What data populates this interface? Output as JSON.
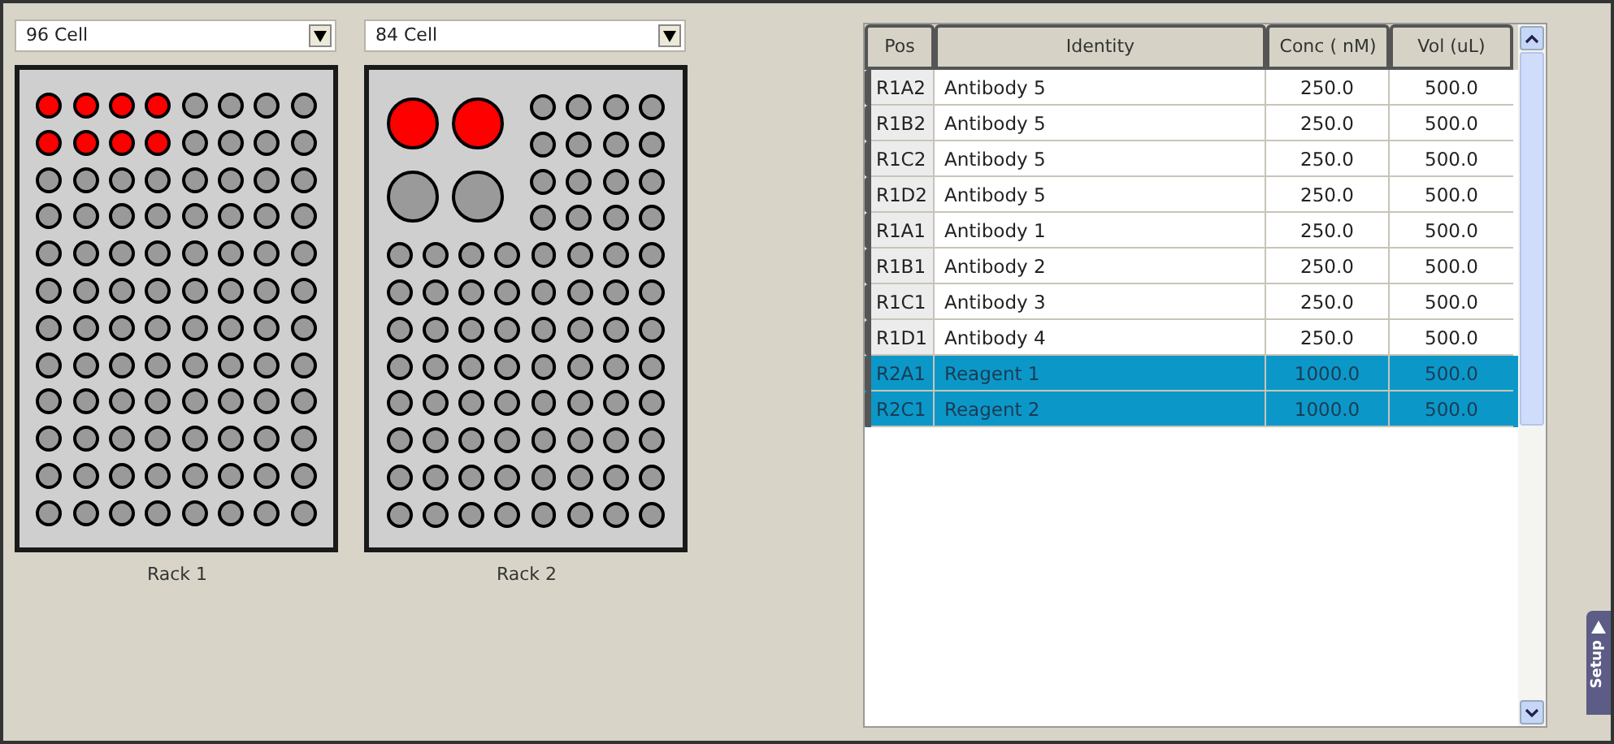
{
  "racks": [
    {
      "kind": "uniform",
      "selector": "96 Cell",
      "label": "Rack 1",
      "rows": [
        [
          true,
          true,
          true,
          true,
          false,
          false,
          false,
          false
        ],
        [
          true,
          true,
          true,
          true,
          false,
          false,
          false,
          false
        ],
        [
          false,
          false,
          false,
          false,
          false,
          false,
          false,
          false
        ],
        [
          false,
          false,
          false,
          false,
          false,
          false,
          false,
          false
        ],
        [
          false,
          false,
          false,
          false,
          false,
          false,
          false,
          false
        ],
        [
          false,
          false,
          false,
          false,
          false,
          false,
          false,
          false
        ],
        [
          false,
          false,
          false,
          false,
          false,
          false,
          false,
          false
        ],
        [
          false,
          false,
          false,
          false,
          false,
          false,
          false,
          false
        ],
        [
          false,
          false,
          false,
          false,
          false,
          false,
          false,
          false
        ],
        [
          false,
          false,
          false,
          false,
          false,
          false,
          false,
          false
        ],
        [
          false,
          false,
          false,
          false,
          false,
          false,
          false,
          false
        ],
        [
          false,
          false,
          false,
          false,
          false,
          false,
          false,
          false
        ]
      ]
    },
    {
      "kind": "mixed",
      "selector": "84 Cell",
      "label": "Rack 2",
      "large_wells": [
        [
          true,
          true
        ],
        [
          false,
          false
        ]
      ],
      "rows": [
        [
          false,
          false,
          false,
          false
        ],
        [
          false,
          false,
          false,
          false
        ],
        [
          false,
          false,
          false,
          false
        ],
        [
          false,
          false,
          false,
          false
        ],
        [
          false,
          false,
          false,
          false,
          false,
          false,
          false,
          false
        ],
        [
          false,
          false,
          false,
          false,
          false,
          false,
          false,
          false
        ],
        [
          false,
          false,
          false,
          false,
          false,
          false,
          false,
          false
        ],
        [
          false,
          false,
          false,
          false,
          false,
          false,
          false,
          false
        ],
        [
          false,
          false,
          false,
          false,
          false,
          false,
          false,
          false
        ],
        [
          false,
          false,
          false,
          false,
          false,
          false,
          false,
          false
        ],
        [
          false,
          false,
          false,
          false,
          false,
          false,
          false,
          false
        ],
        [
          false,
          false,
          false,
          false,
          false,
          false,
          false,
          false
        ]
      ]
    }
  ],
  "table": {
    "columns": [
      "Pos",
      "Identity",
      "Conc ( nM)",
      "Vol (uL)"
    ],
    "rows": [
      {
        "pos": "R1A2",
        "identity": "Antibody 5",
        "conc": "250.0",
        "vol": "500.0",
        "selected": false
      },
      {
        "pos": "R1B2",
        "identity": "Antibody 5",
        "conc": "250.0",
        "vol": "500.0",
        "selected": false
      },
      {
        "pos": "R1C2",
        "identity": "Antibody 5",
        "conc": "250.0",
        "vol": "500.0",
        "selected": false
      },
      {
        "pos": "R1D2",
        "identity": "Antibody 5",
        "conc": "250.0",
        "vol": "500.0",
        "selected": false
      },
      {
        "pos": "R1A1",
        "identity": "Antibody 1",
        "conc": "250.0",
        "vol": "500.0",
        "selected": false
      },
      {
        "pos": "R1B1",
        "identity": "Antibody 2",
        "conc": "250.0",
        "vol": "500.0",
        "selected": false
      },
      {
        "pos": "R1C1",
        "identity": "Antibody 3",
        "conc": "250.0",
        "vol": "500.0",
        "selected": false
      },
      {
        "pos": "R1D1",
        "identity": "Antibody 4",
        "conc": "250.0",
        "vol": "500.0",
        "selected": false
      },
      {
        "pos": "R2A1",
        "identity": "Reagent 1",
        "conc": "1000.0",
        "vol": "500.0",
        "selected": true
      },
      {
        "pos": "R2C1",
        "identity": "Reagent 2",
        "conc": "1000.0",
        "vol": "500.0",
        "selected": true
      }
    ]
  },
  "side_tab": {
    "label": "Setup"
  }
}
